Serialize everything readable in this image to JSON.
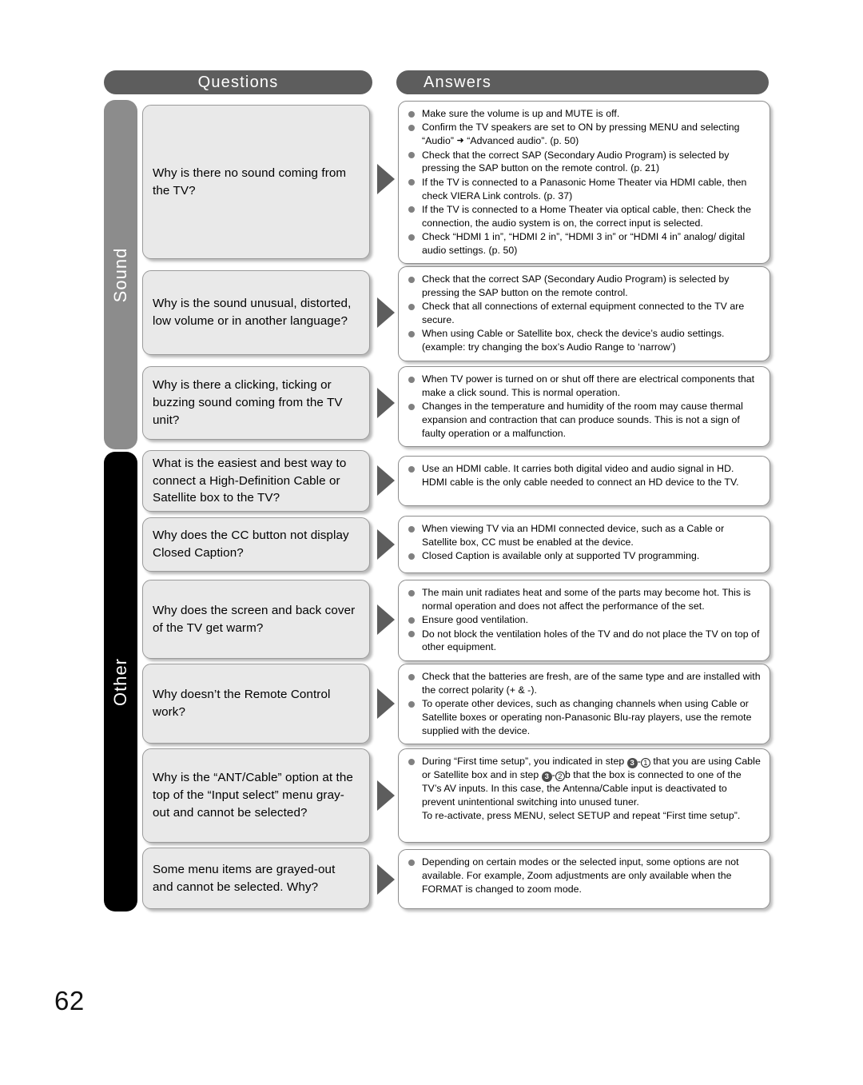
{
  "page": {
    "number": "62"
  },
  "headers": {
    "questions": "Questions",
    "answers": "Answers"
  },
  "categories": [
    {
      "id": "sound",
      "label": "Sound",
      "color": "#8c8c8c"
    },
    {
      "id": "other",
      "label": "Other",
      "color": "#000000"
    }
  ],
  "rows": [
    {
      "category": "sound",
      "question": "Why is there no sound coming from the TV?",
      "answers": [
        "Make sure the volume is up and MUTE is off.",
        "Confirm the TV speakers are set to ON by pressing MENU and selecting “Audio” ➜ “Advanced audio”. (p. 50)",
        "Check that the correct SAP (Secondary Audio Program) is selected by pressing the SAP button on the remote control. (p. 21)",
        "If the TV is connected to a Panasonic Home Theater via HDMI cable, then check VIERA Link controls. (p. 37)",
        "If the TV is connected to a Home Theater via optical cable, then: Check the connection, the audio system is on, the correct input is selected.",
        "Check “HDMI 1 in”, “HDMI 2 in”, “HDMI 3 in” or “HDMI 4 in” analog/ digital audio settings. (p. 50)"
      ]
    },
    {
      "category": "sound",
      "question": "Why is the sound unusual, distorted, low volume or in another language?",
      "answers": [
        "Check that the correct SAP (Secondary Audio Program) is selected by pressing the SAP button on the remote control.",
        "Check that all connections of external equipment connected to the TV are secure.",
        "When using Cable or Satellite box, check the device’s audio settings. (example: try changing the box’s Audio Range to ‘narrow’)"
      ]
    },
    {
      "category": "sound",
      "question": "Why is there a clicking, ticking or buzzing sound coming from the TV unit?",
      "answers": [
        "When TV power is turned on or shut off there are electrical components that make a click sound. This is normal operation.",
        "Changes in the temperature and humidity of the room may cause thermal expansion and contraction that can produce sounds. This is not a sign of faulty operation or a malfunction."
      ]
    },
    {
      "category": "other",
      "question": "What is the easiest and best way to connect a High-Definition Cable or Satellite box to the TV?",
      "answers": [
        "Use an HDMI cable. It carries both digital video and audio signal in HD. HDMI cable is the only cable needed to connect an HD device to the TV."
      ]
    },
    {
      "category": "other",
      "question": "Why does the CC button not display Closed Caption?",
      "answers": [
        "When viewing TV via an HDMI connected device, such as a Cable or Satellite box, CC must be enabled at the device.",
        "Closed Caption is available only at supported TV programming."
      ]
    },
    {
      "category": "other",
      "question": "Why does the screen and back cover of the TV get warm?",
      "answers": [
        "The main unit radiates heat and some of the parts may become hot. This is normal operation and does not affect the performance of the set.",
        "Ensure good ventilation.",
        "Do not block the ventilation holes of the TV and do not place the TV on top of other equipment."
      ]
    },
    {
      "category": "other",
      "question": "Why doesn’t the Remote Control work?",
      "answers": [
        "Check that the batteries are fresh, are of the same type and are installed with the correct polarity (+ & -).",
        "To operate other devices, such as changing channels when using Cable or Satellite boxes or operating non-Panasonic Blu-ray players, use the remote supplied with the device."
      ]
    },
    {
      "category": "other",
      "question": "Why is the “ANT/Cable” option at the top of the “Input select” menu gray-out and cannot be selected?",
      "answers": [
        "During “First time setup”, you indicated in step ③-① that you are using Cable or Satellite box and in step ③-②b that the box is connected to one of the TV’s AV inputs. In this case, the Antenna/Cable input is deactivated to prevent unintentional switching into unused tuner.",
        "To re-activate, press MENU, select SETUP and repeat “First time setup”."
      ]
    },
    {
      "category": "other",
      "question": "Some menu items are grayed-out and cannot be selected. Why?",
      "answers": [
        "Depending on certain modes or the selected input, some options are not available. For example, Zoom adjustments are only available when the FORMAT is changed to zoom mode."
      ]
    }
  ]
}
